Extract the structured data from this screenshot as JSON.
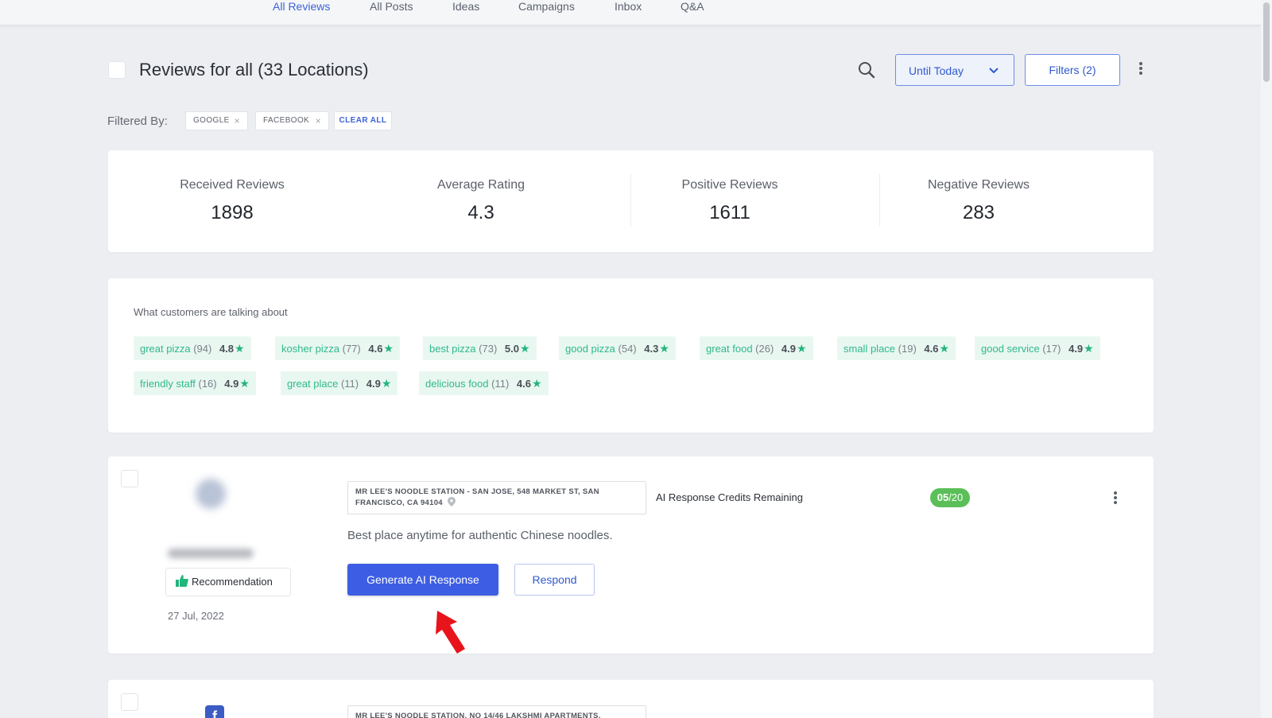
{
  "nav": {
    "tabs": [
      {
        "label": "All Reviews",
        "active": true
      },
      {
        "label": "All Posts",
        "active": false
      },
      {
        "label": "Ideas",
        "active": false
      },
      {
        "label": "Campaigns",
        "active": false
      },
      {
        "label": "Inbox",
        "active": false
      },
      {
        "label": "Q&A",
        "active": false
      }
    ]
  },
  "header": {
    "title": "Reviews for all (33 Locations)",
    "search_icon": "search-icon",
    "date_filter": "Until Today",
    "filters_button": "Filters (2)"
  },
  "filters": {
    "label": "Filtered By:",
    "chips": [
      "GOOGLE",
      "FACEBOOK"
    ],
    "clear_all": "CLEAR ALL"
  },
  "stats": [
    {
      "label": "Received Reviews",
      "value": "1898"
    },
    {
      "label": "Average Rating",
      "value": "4.3"
    },
    {
      "label": "Positive Reviews",
      "value": "1611"
    },
    {
      "label": "Negative Reviews",
      "value": "283"
    }
  ],
  "topics": {
    "title": "What customers are talking about",
    "items": [
      {
        "term": "great pizza",
        "count": "(94)",
        "rating": "4.8"
      },
      {
        "term": "kosher pizza",
        "count": "(77)",
        "rating": "4.6"
      },
      {
        "term": "best pizza",
        "count": "(73)",
        "rating": "5.0"
      },
      {
        "term": "good pizza",
        "count": "(54)",
        "rating": "4.3"
      },
      {
        "term": "great food",
        "count": "(26)",
        "rating": "4.9"
      },
      {
        "term": "small place",
        "count": "(19)",
        "rating": "4.6"
      },
      {
        "term": "good service",
        "count": "(17)",
        "rating": "4.9"
      },
      {
        "term": "friendly staff",
        "count": "(16)",
        "rating": "4.9"
      },
      {
        "term": "great place",
        "count": "(11)",
        "rating": "4.9"
      },
      {
        "term": "delicious food",
        "count": "(11)",
        "rating": "4.6"
      }
    ]
  },
  "review": {
    "recommendation": "Recommendation",
    "date": "27 Jul, 2022",
    "location_line1": "MR LEE'S NOODLE STATION - SAN JOSE, 548 MARKET ST, SAN",
    "location_line2": "FRANCISCO, CA 94104",
    "credits_label": "AI Response Credits Remaining",
    "credits_used": "05",
    "credits_total": "/20",
    "text": "Best place anytime for authentic Chinese noodles.",
    "ai_button": "Generate AI Response",
    "respond_button": "Respond"
  },
  "review2": {
    "location_line1": "MR LEE'S NOODLE STATION, NO 14/46 LAKSHMI APARTMENTS,"
  },
  "colors": {
    "accent": "#3d5ee4",
    "topic_text": "#2fb98b",
    "credit_badge": "#5bbf58",
    "annotation_arrow": "#e8141b"
  }
}
